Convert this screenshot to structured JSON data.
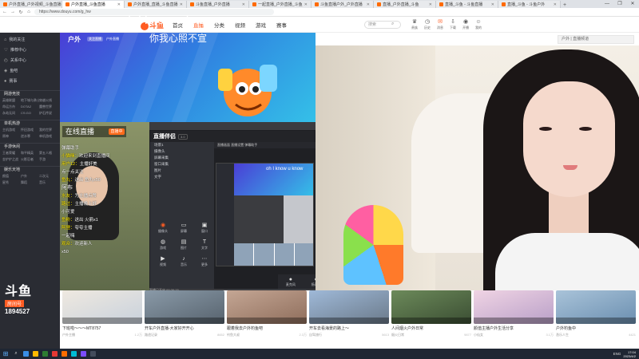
{
  "browser": {
    "tabs": [
      {
        "label": "户外直播_户外视频_斗鱼直播",
        "active": false
      },
      {
        "label": "户外直播_斗鱼直播",
        "active": true
      },
      {
        "label": "户外直播_直播_斗鱼直播",
        "active": false
      },
      {
        "label": "斗鱼直播_户外直播",
        "active": false
      },
      {
        "label": "一起直播_户外直播_斗鱼",
        "active": false
      },
      {
        "label": "斗鱼直播户外_户外直播",
        "active": false
      },
      {
        "label": "直播_户外直播_斗鱼",
        "active": false
      },
      {
        "label": "直播_斗鱼 - 斗鱼直播",
        "active": false
      },
      {
        "label": "直播_斗鱼 - 斗鱼户外",
        "active": false
      }
    ],
    "url": "https://www.douyu.com/g_hw",
    "new_tab": "+",
    "win_min": "—",
    "win_max": "❐",
    "win_close": "✕"
  },
  "header": {
    "logo": "斗鱼",
    "nav": [
      {
        "label": "首页",
        "active": false
      },
      {
        "label": "直播",
        "active": true
      },
      {
        "label": "分类",
        "active": false
      },
      {
        "label": "视频",
        "active": false
      },
      {
        "label": "游戏",
        "active": false
      },
      {
        "label": "赛事",
        "active": false
      }
    ],
    "search_placeholder": "搜索",
    "icons": [
      {
        "icon": "crown-icon",
        "glyph": "♛",
        "label": "贵族",
        "accent": false
      },
      {
        "icon": "history-icon",
        "glyph": "◷",
        "label": "历史",
        "accent": false
      },
      {
        "icon": "message-icon",
        "glyph": "✉",
        "label": "消息",
        "accent": true
      },
      {
        "icon": "download-icon",
        "glyph": "⇩",
        "label": "下载",
        "accent": false
      },
      {
        "icon": "broadcast-icon",
        "glyph": "◉",
        "label": "开播",
        "accent": false
      },
      {
        "icon": "user-icon",
        "glyph": "☺",
        "label": "我的",
        "accent": false
      }
    ]
  },
  "sidebar": {
    "top_items": [
      {
        "icon": "home-icon",
        "glyph": "⌂",
        "label": "我的关注"
      },
      {
        "icon": "heart-icon",
        "glyph": "♡",
        "label": "推荐中心"
      },
      {
        "icon": "chart-icon",
        "glyph": "◴",
        "label": "关系中心"
      },
      {
        "icon": "fish-icon",
        "glyph": "◈",
        "label": "鱼吧"
      },
      {
        "icon": "dot-icon",
        "glyph": "●",
        "label": "赛事"
      }
    ],
    "sections": [
      {
        "title": "网游竞技",
        "items": [
          "英雄联盟",
          "地下城与勇士",
          "穿越火线",
          "命运方舟",
          "DOTA2",
          "魔兽世界",
          "永劫无间",
          "CS:GO",
          "炉石传说"
        ]
      },
      {
        "title": "单机热游",
        "items": [
          "主机游戏",
          "怀旧游戏",
          "我的世界",
          "原神",
          "逆水寒",
          "单机游戏"
        ]
      },
      {
        "title": "手游休闲",
        "items": [
          "王者荣耀",
          "和平精英",
          "第五人格",
          "金铲铲之战",
          "火影忍者",
          "手游"
        ]
      },
      {
        "title": "娱乐天地",
        "items": [
          "颜值",
          "户外",
          "二次元",
          "星秀",
          "舞蹈",
          "音乐"
        ]
      }
    ]
  },
  "brand": {
    "logo_text": "斗鱼",
    "room_label": "房间号",
    "room_number": "1894527"
  },
  "banner": {
    "category": "户外",
    "sub1": "关注直播",
    "sub2": "户外直播"
  },
  "lyrics": {
    "line1": "oh I know u know",
    "line2": "你我心照不宣"
  },
  "right_panel": {
    "text": "户外 | 直播频道"
  },
  "overlay": {
    "online_label": "在线直播",
    "online_tag": "直播中",
    "chat": [
      {
        "user": "",
        "text": "弹幕助手",
        "big": false
      },
      {
        "user": "小猫咪",
        "text": "欢迎来到直播间",
        "big": false
      },
      {
        "user": "用户12",
        "text": "主播好美",
        "big": false
      },
      {
        "user": "",
        "text": "点一点关注",
        "big": false
      },
      {
        "user": "鱼丸",
        "text": "送出 鱼丸x50",
        "big": false
      },
      {
        "user": "",
        "text": "阿布",
        "big": true
      },
      {
        "user": "水友",
        "text": "为主播点赞",
        "big": false
      },
      {
        "user": "路过",
        "text": "主播晚上好",
        "big": false
      },
      {
        "user": "",
        "text": "小可爱",
        "big": false
      },
      {
        "user": "鱼粉",
        "text": "送出 火箭x1",
        "big": false
      },
      {
        "user": "阿狸",
        "text": "夸夸主播",
        "big": false
      },
      {
        "user": "",
        "text": "一起嗨",
        "big": false
      },
      {
        "user": "观众",
        "text": "欢迎新人",
        "big": false
      },
      {
        "user": "",
        "text": "x50",
        "big": false
      }
    ]
  },
  "streamer_software": {
    "name": "直播伴侣",
    "version": "3.0",
    "scenes": [
      "场景1",
      "摄像头",
      "屏幕采集",
      "窗口采集",
      "图片",
      "文字"
    ],
    "tabs": "直播画面  直播设置  弹幕助手",
    "buttons": [
      {
        "icon": "camera-icon",
        "glyph": "◉",
        "label": "摄像头",
        "hot": true
      },
      {
        "icon": "monitor-icon",
        "glyph": "▭",
        "label": "屏幕",
        "hot": false
      },
      {
        "icon": "window-icon",
        "glyph": "▣",
        "label": "窗口",
        "hot": false
      },
      {
        "icon": "game-icon",
        "glyph": "◍",
        "label": "游戏",
        "hot": false
      },
      {
        "icon": "image-icon",
        "glyph": "▤",
        "label": "图片",
        "hot": false
      },
      {
        "icon": "text-icon",
        "glyph": "T",
        "label": "文字",
        "hot": false
      },
      {
        "icon": "video-icon",
        "glyph": "▶",
        "label": "视频",
        "hot": false
      },
      {
        "icon": "music-icon",
        "glyph": "♪",
        "label": "音乐",
        "hot": false
      },
      {
        "icon": "more-icon",
        "glyph": "⋯",
        "label": "更多",
        "hot": false
      }
    ],
    "bottom": [
      {
        "icon": "mic-icon",
        "glyph": "●",
        "label": "麦克风"
      },
      {
        "icon": "speaker-icon",
        "glyph": "◐",
        "label": "扬声器"
      },
      {
        "icon": "record-icon",
        "glyph": "◎",
        "label": "录制"
      },
      {
        "icon": "start-icon",
        "glyph": "▶",
        "label": "开始直播"
      }
    ],
    "status": "直播已开启 00:36:15"
  },
  "cards": [
    {
      "title": "下班啦～～～MT8757",
      "anchor": "户外主播",
      "viewers": "1.2万",
      "colors": [
        "#efe9e0",
        "#c8d1dc"
      ]
    },
    {
      "title": "开车户外直播-大家好开开心",
      "anchor": "路途记录",
      "viewers": "8652",
      "colors": [
        "#8a9aa8",
        "#57636e"
      ]
    },
    {
      "title": "跟着我去户外钓鱼吧",
      "anchor": "钓鱼大叔",
      "viewers": "2.3万",
      "colors": [
        "#c4a694",
        "#8f6e5c"
      ]
    },
    {
      "title": "开车去看海景的路上～",
      "anchor": "自驾旅行",
      "viewers": "5613",
      "colors": [
        "#9fb9d8",
        "#6b7a8a"
      ]
    },
    {
      "title": "人间烟火户外日常",
      "anchor": "烟火日常",
      "viewers": "9877",
      "colors": [
        "#6c8a5a",
        "#3b4e33"
      ]
    },
    {
      "title": "颜值主播户外生活分享",
      "anchor": "小仙女",
      "viewers": "3.1万",
      "colors": [
        "#f0d4e4",
        "#b9a0c8"
      ]
    },
    {
      "title": "户外钓鱼中",
      "anchor": "渔乐人生",
      "viewers": "4421",
      "colors": [
        "#a9c3d9",
        "#6b8fb0"
      ]
    }
  ],
  "taskbar": {
    "start_glyph": "⊞",
    "search_glyph": "⌕",
    "apps": [
      "#3a8ee6",
      "#ffb900",
      "#2d7d32",
      "#e53935",
      "#ff6d00",
      "#00bcd4",
      "#7c4dff",
      "#444c5c"
    ],
    "tray": "ENG",
    "time": "17:04",
    "date": "2023/4/2"
  }
}
